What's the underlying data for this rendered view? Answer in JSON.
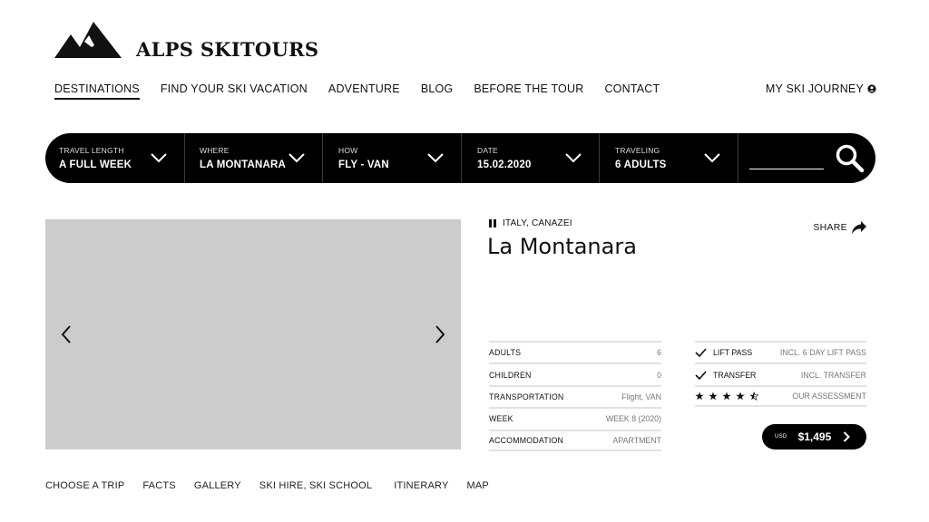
{
  "brand": {
    "name": "ALPS SKITOURS",
    "logo_icon": "mountain-peaks-icon"
  },
  "nav": {
    "items": [
      {
        "label": "DESTINATIONS",
        "active": true
      },
      {
        "label": "FIND YOUR SKI VACATION",
        "active": false
      },
      {
        "label": "ADVENTURE",
        "active": false
      },
      {
        "label": "BLOG",
        "active": false
      },
      {
        "label": "BEFORE THE TOUR",
        "active": false
      },
      {
        "label": "CONTACT",
        "active": false
      }
    ],
    "account_label": "MY SKI JOURNEY",
    "account_icon": "user-circle-icon"
  },
  "search": {
    "fields": [
      {
        "label": "TRAVEL LENGTH",
        "value": "A FULL WEEK"
      },
      {
        "label": "WHERE",
        "value": "LA MONTANARA"
      },
      {
        "label": "HOW",
        "value": "FLY - VAN"
      },
      {
        "label": "DATE",
        "value": "15.02.2020"
      },
      {
        "label": "TRAVELING",
        "value": "6 ADULTS"
      }
    ],
    "search_icon": "search-icon"
  },
  "gallery": {
    "prev_icon": "chevron-left-icon",
    "next_icon": "chevron-right-icon",
    "placeholder_color": "#cccccc"
  },
  "subnav": {
    "items": [
      "CHOOSE A TRIP",
      "FACTS",
      "GALLERY",
      "SKI HIRE, SKI SCHOOL",
      "ITINERARY",
      "MAP"
    ]
  },
  "details": {
    "location": "ITALY, CANAZEI",
    "title": "La Montanara",
    "share_label": "SHARE",
    "share_icon": "share-arrow-icon",
    "facts": [
      {
        "label": "ADULTS",
        "value": "6"
      },
      {
        "label": "CHILDREN",
        "value": "0"
      },
      {
        "label": "TRANSPORTATION",
        "value": "Flight, VAN"
      },
      {
        "label": "WEEK",
        "value": "WEEK 8 (2020)"
      },
      {
        "label": "ACCOMMODATION",
        "value": "APARTMENT"
      }
    ],
    "inclusions": [
      {
        "label": "LIFT PASS",
        "value": "INCL. 6 DAY LIFT PASS",
        "icon": "check-icon"
      },
      {
        "label": "TRANSFER",
        "value": "INCL. TRANSFER",
        "icon": "check-icon"
      }
    ],
    "assessment": {
      "rating": 4.5,
      "max": 5,
      "label": "OUR ASSESSMENT"
    }
  },
  "price": {
    "currency": "USD",
    "amount": "$1,495",
    "icon": "chevron-right-icon"
  },
  "colors": {
    "primary": "#000000",
    "placeholder": "#cccccc",
    "divider": "#e2e2e2",
    "muted_text": "#777777"
  }
}
